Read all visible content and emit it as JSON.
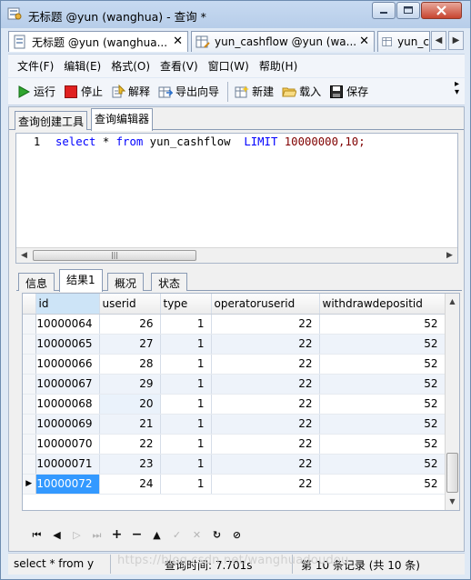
{
  "window": {
    "title": "无标题 @yun (wanghua) - 查询 *"
  },
  "doc_tabs": [
    {
      "label": "无标题 @yun (wanghua..."
    },
    {
      "label": "yun_cashflow @yun (wa..."
    },
    {
      "label": "yun_c"
    }
  ],
  "menu": {
    "items": [
      "文件(F)",
      "编辑(E)",
      "格式(O)",
      "查看(V)",
      "窗口(W)",
      "帮助(H)"
    ]
  },
  "toolbar": {
    "run": "运行",
    "stop": "停止",
    "explain": "解释",
    "export_wizard": "导出向导",
    "new": "新建",
    "load": "载入",
    "save": "保存"
  },
  "query_tabs": {
    "builder": "查询创建工具",
    "editor": "查询编辑器"
  },
  "editor": {
    "line_number": "1",
    "sql": {
      "kw_select": "select",
      "star": " * ",
      "kw_from": "from",
      "table": " yun_cashflow  ",
      "kw_limit": "LIMIT",
      "limit_values": " 10000000,10;"
    },
    "scroll_grip": "|||"
  },
  "result_tabs": [
    "信息",
    "结果1",
    "概况",
    "状态"
  ],
  "grid": {
    "columns": [
      "id",
      "userid",
      "type",
      "operatoruserid",
      "withdrawdepositid"
    ],
    "rows": [
      [
        "10000064",
        "26",
        "1",
        "22",
        "52"
      ],
      [
        "10000065",
        "27",
        "1",
        "22",
        "52"
      ],
      [
        "10000066",
        "28",
        "1",
        "22",
        "52"
      ],
      [
        "10000067",
        "29",
        "1",
        "22",
        "52"
      ],
      [
        "10000068",
        "20",
        "1",
        "22",
        "52"
      ],
      [
        "10000069",
        "21",
        "1",
        "22",
        "52"
      ],
      [
        "10000070",
        "22",
        "1",
        "22",
        "52"
      ],
      [
        "10000071",
        "23",
        "1",
        "22",
        "52"
      ],
      [
        "10000072",
        "24",
        "1",
        "22",
        "52"
      ]
    ],
    "current_row_indicator": "▶"
  },
  "statusbar": {
    "query": "select * from y",
    "query_time": "查询时间: 7.701s",
    "record_info": "第 10 条记录 (共 10 条)"
  },
  "watermark": "https://blog.csdn.net/wanghuadoudou",
  "colors": {
    "selection": "#3399ff",
    "keyword": "#0000ff",
    "number": "#800000"
  }
}
